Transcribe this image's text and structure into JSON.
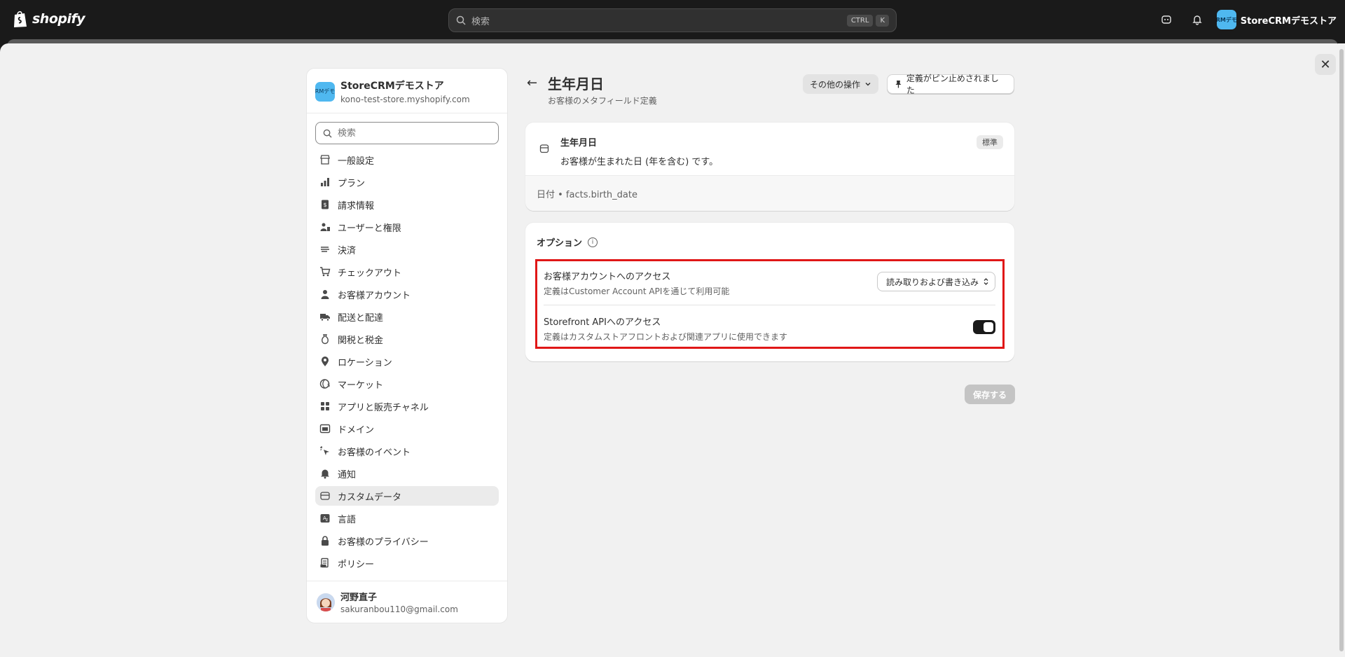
{
  "topbar": {
    "brand": "shopify",
    "search_placeholder": "検索",
    "shortcut_keys": [
      "CTRL",
      "K"
    ],
    "store_name": "StoreCRMデモストア",
    "store_avatar_text": "RMデモ"
  },
  "nav": {
    "store_name": "StoreCRMデモストア",
    "store_url": "kono-test-store.myshopify.com",
    "store_avatar_text": "RMデモ",
    "search_placeholder": "検索",
    "items": [
      {
        "label": "一般設定",
        "icon": "store-icon"
      },
      {
        "label": "プラン",
        "icon": "plan-chart-icon"
      },
      {
        "label": "請求情報",
        "icon": "billing-icon"
      },
      {
        "label": "ユーザーと権限",
        "icon": "users-icon"
      },
      {
        "label": "決済",
        "icon": "payments-icon"
      },
      {
        "label": "チェックアウト",
        "icon": "cart-icon"
      },
      {
        "label": "お客様アカウント",
        "icon": "person-icon"
      },
      {
        "label": "配送と配達",
        "icon": "truck-icon"
      },
      {
        "label": "関税と税金",
        "icon": "money-bag-icon"
      },
      {
        "label": "ロケーション",
        "icon": "location-pin-icon"
      },
      {
        "label": "マーケット",
        "icon": "globe-icon"
      },
      {
        "label": "アプリと販売チャネル",
        "icon": "apps-icon"
      },
      {
        "label": "ドメイン",
        "icon": "domain-icon"
      },
      {
        "label": "お客様のイベント",
        "icon": "cursor-click-icon"
      },
      {
        "label": "通知",
        "icon": "bell-icon"
      },
      {
        "label": "カスタムデータ",
        "icon": "custom-data-icon",
        "active": true
      },
      {
        "label": "言語",
        "icon": "language-icon"
      },
      {
        "label": "お客様のプライバシー",
        "icon": "lock-icon"
      },
      {
        "label": "ポリシー",
        "icon": "policy-icon"
      }
    ],
    "user_name": "河野直子",
    "user_email": "sakuranbou110@gmail.com"
  },
  "page": {
    "title": "生年月日",
    "subtitle": "お客様のメタフィールド定義",
    "more_actions": "その他の操作",
    "pinned": "定義がピン止めされました"
  },
  "definition": {
    "name": "生年月日",
    "description": "お客様が生まれた日 (年を含む) です。",
    "badge": "標準",
    "type_line": "日付 • facts.birth_date"
  },
  "options": {
    "title": "オプション",
    "customer_account": {
      "title": "お客様アカウントへのアクセス",
      "description": "定義はCustomer Account APIを通じて利用可能",
      "value": "読み取りおよび書き込み"
    },
    "storefront": {
      "title": "Storefront APIへのアクセス",
      "description": "定義はカスタムストアフロントおよび関連アプリに使用できます",
      "enabled": true
    }
  },
  "save_label": "保存する"
}
